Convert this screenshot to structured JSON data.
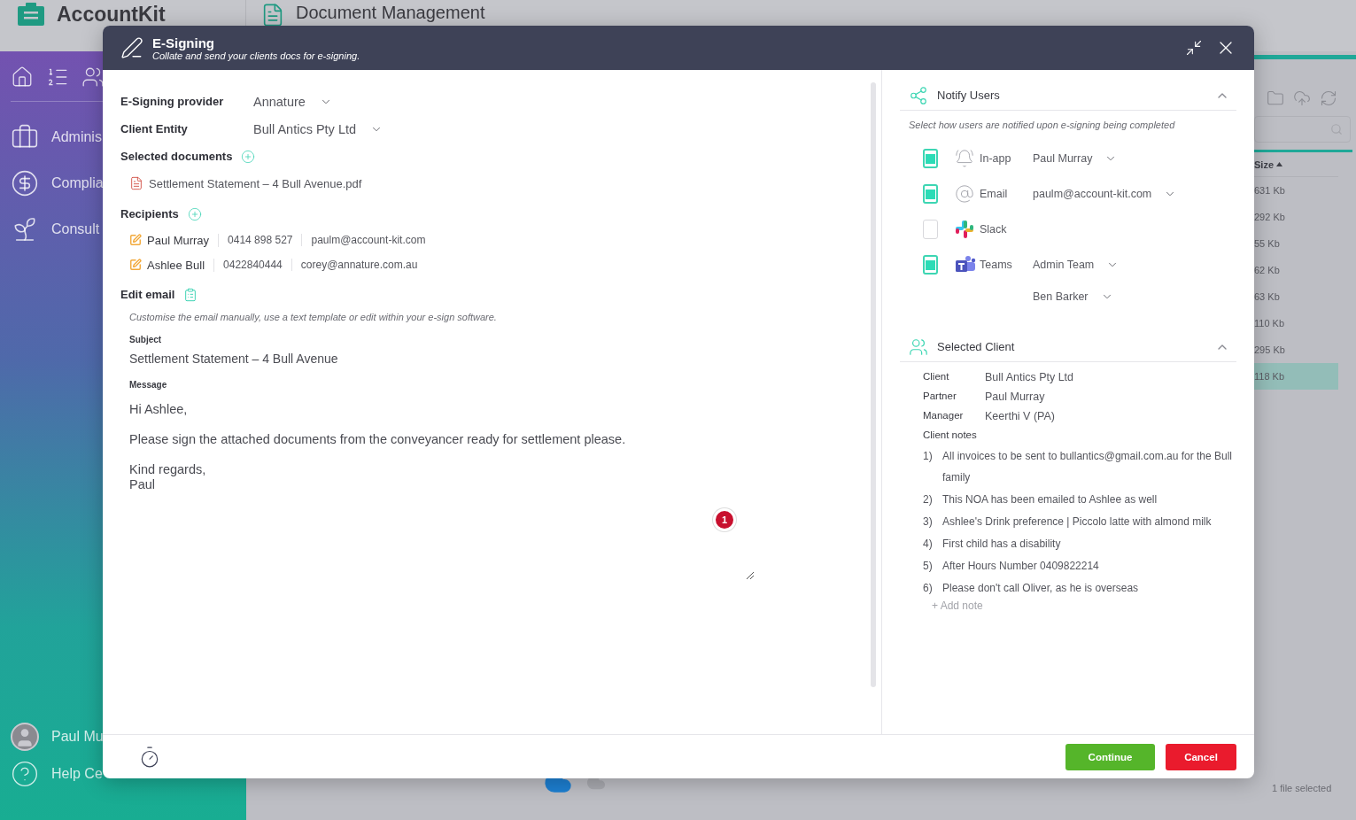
{
  "app": {
    "logo": "AccountKit",
    "page_title": "Document Management"
  },
  "sidebar": {
    "items": [
      {
        "label": "Adminis",
        "kind": "briefcase"
      },
      {
        "label": "Complia",
        "kind": "dollar"
      },
      {
        "label": "Consult",
        "kind": "plant"
      }
    ],
    "user": "Paul Mu",
    "help": "Help Ce"
  },
  "file_list": {
    "column": "Size",
    "rows": [
      {
        "size": "631 Kb",
        "selected": false
      },
      {
        "size": "292 Kb",
        "selected": false
      },
      {
        "size": "55 Kb",
        "selected": false
      },
      {
        "size": "62 Kb",
        "selected": false
      },
      {
        "size": "63 Kb",
        "selected": false
      },
      {
        "size": "110 Kb",
        "selected": false
      },
      {
        "size": "295 Kb",
        "selected": false
      },
      {
        "size": "118 Kb",
        "selected": true
      }
    ],
    "status": "1 file selected"
  },
  "dialog": {
    "title": "E-Signing",
    "subtitle": "Collate and send your clients docs for e-signing.",
    "provider": {
      "label": "E-Signing provider",
      "value": "Annature"
    },
    "client_entity": {
      "label": "Client Entity",
      "value": "Bull Antics Pty Ltd"
    },
    "documents": {
      "label": "Selected documents",
      "files": [
        "Settlement Statement – 4 Bull Avenue.pdf"
      ]
    },
    "recipients": {
      "label": "Recipients",
      "rows": [
        {
          "name": "Paul Murray",
          "phone": "0414 898 527",
          "email": "paulm@account-kit.com"
        },
        {
          "name": "Ashlee Bull",
          "phone": "0422840444",
          "email": "corey@annature.com.au"
        }
      ]
    },
    "edit_email": {
      "label": "Edit email",
      "hint": "Customise the email manually, use a text template or edit within your e-sign software.",
      "subject_label": "Subject",
      "subject": "Settlement Statement – 4 Bull Avenue",
      "message_label": "Message",
      "message": "Hi Ashlee,\n\nPlease sign the attached documents from the conveyancer ready for settlement please.\n\nKind regards,\nPaul",
      "badge": "1"
    },
    "notify": {
      "title": "Notify Users",
      "expanded": true,
      "hint": "Select how users are notified upon e-signing being completed",
      "channels": [
        {
          "kind": "in-app",
          "label": "In-app",
          "checked": true,
          "recipients": [
            "Paul Murray"
          ]
        },
        {
          "kind": "email",
          "label": "Email",
          "checked": true,
          "recipients": [
            "paulm@account-kit.com"
          ]
        },
        {
          "kind": "slack",
          "label": "Slack",
          "checked": false
        },
        {
          "kind": "teams",
          "label": "Teams",
          "checked": true,
          "recipients": [
            "Admin Team",
            "Ben Barker"
          ]
        }
      ]
    },
    "client": {
      "title": "Selected Client",
      "expanded": true,
      "fields": [
        {
          "label": "Client",
          "value": "Bull Antics Pty Ltd"
        },
        {
          "label": "Partner",
          "value": "Paul Murray"
        },
        {
          "label": "Manager",
          "value": "Keerthi V (PA)"
        }
      ],
      "notes_label": "Client notes",
      "notes": [
        {
          "number": "1)",
          "text": "All invoices to be sent to bullantics@gmail.com.au for the Bull family"
        },
        {
          "number": "2)",
          "text": "This NOA has been emailed to Ashlee as well"
        },
        {
          "number": "3)",
          "text": "Ashlee's Drink preference | Piccolo latte with almond milk"
        },
        {
          "number": "4)",
          "text": "First child has a disability"
        },
        {
          "number": "5)",
          "text": "After Hours Number 0409822214"
        },
        {
          "number": "6)",
          "text": "Please don't call Oliver, as he is overseas"
        }
      ],
      "add_note": "+ Add note"
    },
    "buttons": [
      {
        "label": "Continue",
        "kind": "primary"
      },
      {
        "label": "Cancel",
        "kind": "danger"
      }
    ]
  }
}
